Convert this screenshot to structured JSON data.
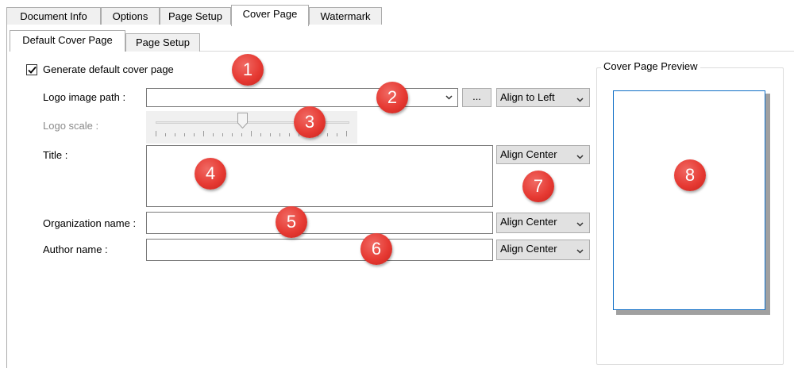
{
  "outer_tabs": [
    "Document Info",
    "Options",
    "Page Setup",
    "Cover Page",
    "Watermark"
  ],
  "inner_tabs": [
    "Default Cover Page",
    "Page Setup"
  ],
  "form": {
    "generate_checkbox_label": "Generate default cover page",
    "generate_checked": true,
    "logo_path_label": "Logo image path :",
    "logo_path_value": "",
    "browse_label": "...",
    "logo_align": "Align to Left",
    "logo_scale_label": "Logo scale :",
    "logo_scale_enabled": false,
    "title_label": "Title :",
    "title_value": "",
    "title_align": "Align Center",
    "org_label": "Organization name :",
    "org_value": "",
    "org_align": "Align Center",
    "author_label": "Author name :",
    "author_value": "",
    "author_align": "Align Center"
  },
  "preview": {
    "group_title": "Cover Page Preview"
  },
  "markers": [
    "1",
    "2",
    "3",
    "4",
    "5",
    "6",
    "7",
    "8"
  ],
  "colors": {
    "marker_red": "#e63a33",
    "preview_border": "#0f6ec6",
    "disabled_text": "#8a8a8a"
  },
  "icons": {
    "checkbox": "checkmark-icon",
    "dropdown": "chevron-down-icon"
  }
}
